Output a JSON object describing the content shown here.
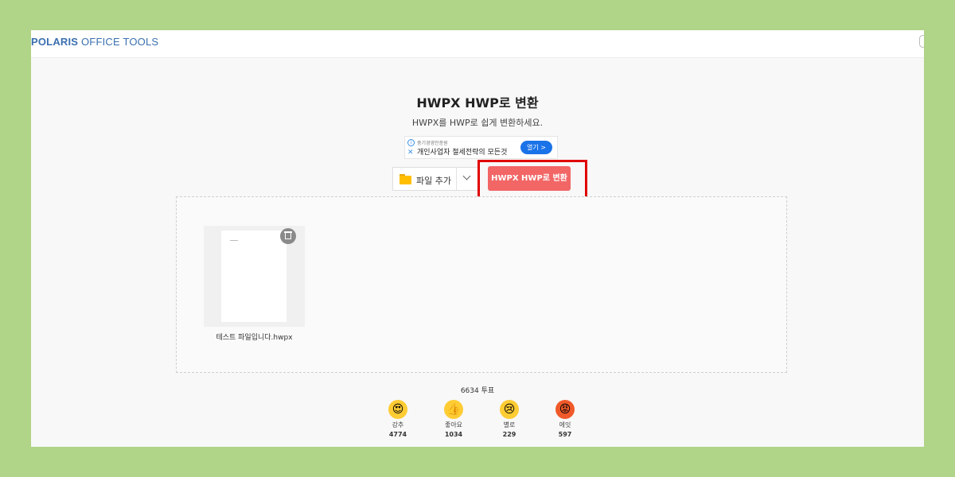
{
  "header": {
    "logo_bold": "POLARIS",
    "logo_rest": " OFFICE TOOLS"
  },
  "main": {
    "title": "HWPX HWP로 변환",
    "subtitle": "HWPX를 HWP로 쉽게 변환하세요."
  },
  "ad": {
    "small_text": "중기경영인증원",
    "main_text": "개인사업자 절세전략의 모든것",
    "cta": "열기 >"
  },
  "toolbar": {
    "add_file_label": "파일 추가",
    "convert_label": "HWPX HWP로 변환"
  },
  "files": [
    {
      "name": "테스트 파일입니다.hwpx"
    }
  ],
  "reactions": {
    "total": "6634 투표",
    "items": [
      {
        "label": "강추",
        "count": "4774",
        "emoji": "😍",
        "color": "#ffcc33"
      },
      {
        "label": "좋아요",
        "count": "1034",
        "emoji": "👍",
        "color": "#ffcc33"
      },
      {
        "label": "별로",
        "count": "229",
        "emoji": "😢",
        "color": "#ffcc33"
      },
      {
        "label": "에잇",
        "count": "597",
        "emoji": "😡",
        "color": "#f05a2a"
      }
    ]
  }
}
